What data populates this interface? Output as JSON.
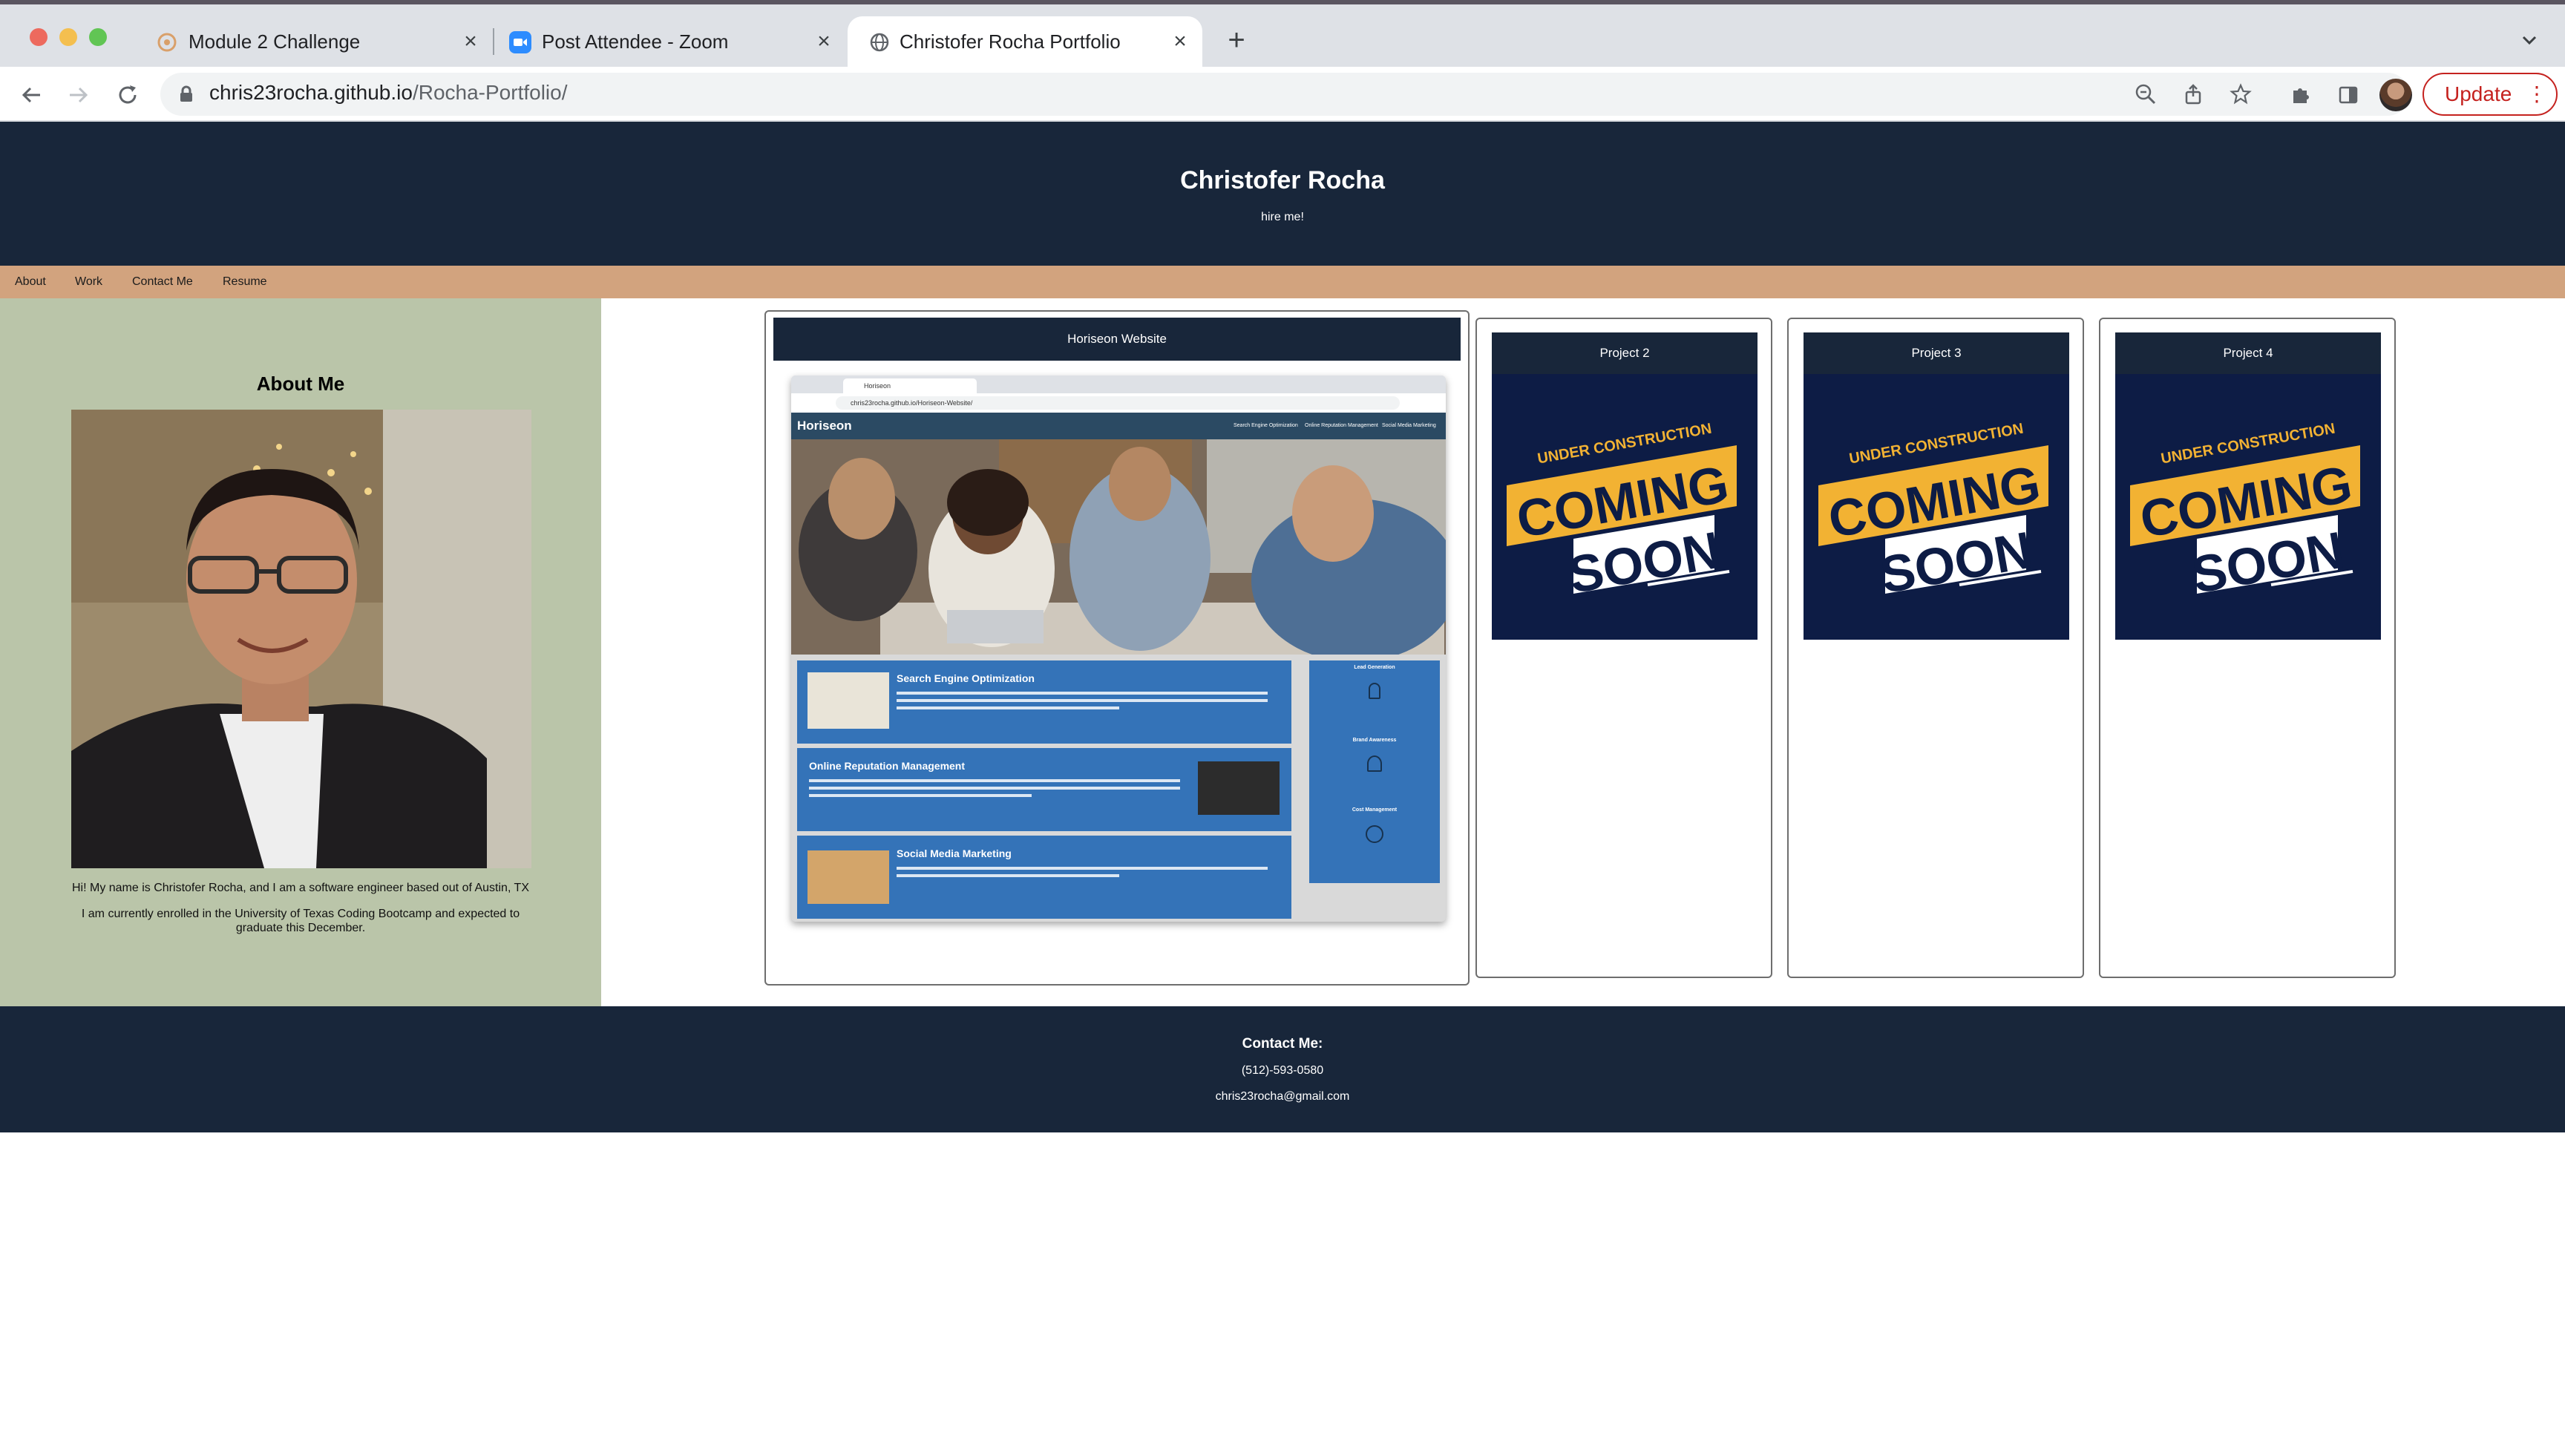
{
  "browser": {
    "tabs": [
      {
        "title": "Module 2 Challenge",
        "icon": "tab-favicon-ut-icon"
      },
      {
        "title": "Post Attendee - Zoom",
        "icon": "zoom-camera-icon"
      },
      {
        "title": "Christofer Rocha Portfolio",
        "icon": "globe-icon"
      }
    ],
    "new_tab_symbol": "+",
    "url_host": "chris23rocha.github.io",
    "url_path": "/Rocha-Portfolio/",
    "update_label": "Update",
    "colors": {
      "tabstrip": "#dee1e6",
      "update": "#c5221f"
    }
  },
  "site": {
    "header": {
      "title": "Christofer Rocha",
      "subtitle": "hire me!"
    },
    "nav": [
      "About",
      "Work",
      "Contact Me",
      "Resume"
    ],
    "about": {
      "heading": "About Me",
      "bio_line1": "Hi! My name is Christofer Rocha, and I am a software engineer based out of Austin, TX",
      "bio_line2": "I am currently enrolled in the University of Texas Coding Bootcamp and expected to graduate this December."
    },
    "projects": [
      {
        "title": "Horiseon Website"
      },
      {
        "title": "Project 2",
        "image_text": [
          "UNDER CONSTRUCTION",
          "COMING",
          "SOON"
        ]
      },
      {
        "title": "Project 3",
        "image_text": [
          "UNDER CONSTRUCTION",
          "COMING",
          "SOON"
        ]
      },
      {
        "title": "Project 4",
        "image_text": [
          "UNDER CONSTRUCTION",
          "COMING",
          "SOON"
        ]
      }
    ],
    "horiseon_preview": {
      "tab": "Horiseon",
      "url": "chris23rocha.github.io/Horiseon-Website/",
      "brand": "Horiseon",
      "nav": [
        "Search Engine Optimization",
        "Online Reputation Management",
        "Social Media Marketing"
      ],
      "sections": [
        "Search Engine Optimization",
        "Online Reputation Management",
        "Social Media Marketing"
      ],
      "benefits": [
        "Lead Generation",
        "Brand Awareness",
        "Cost Management"
      ]
    },
    "footer": {
      "heading": "Contact Me:",
      "phone": "(512)-593-0580",
      "email": "chris23rocha@gmail.com"
    },
    "colors": {
      "navy": "#18263a",
      "tan": "#d2a37e",
      "sage": "#bac5a9",
      "coming_soon_yellow": "#f2b233",
      "coming_soon_bg": "#0d1c45"
    }
  }
}
